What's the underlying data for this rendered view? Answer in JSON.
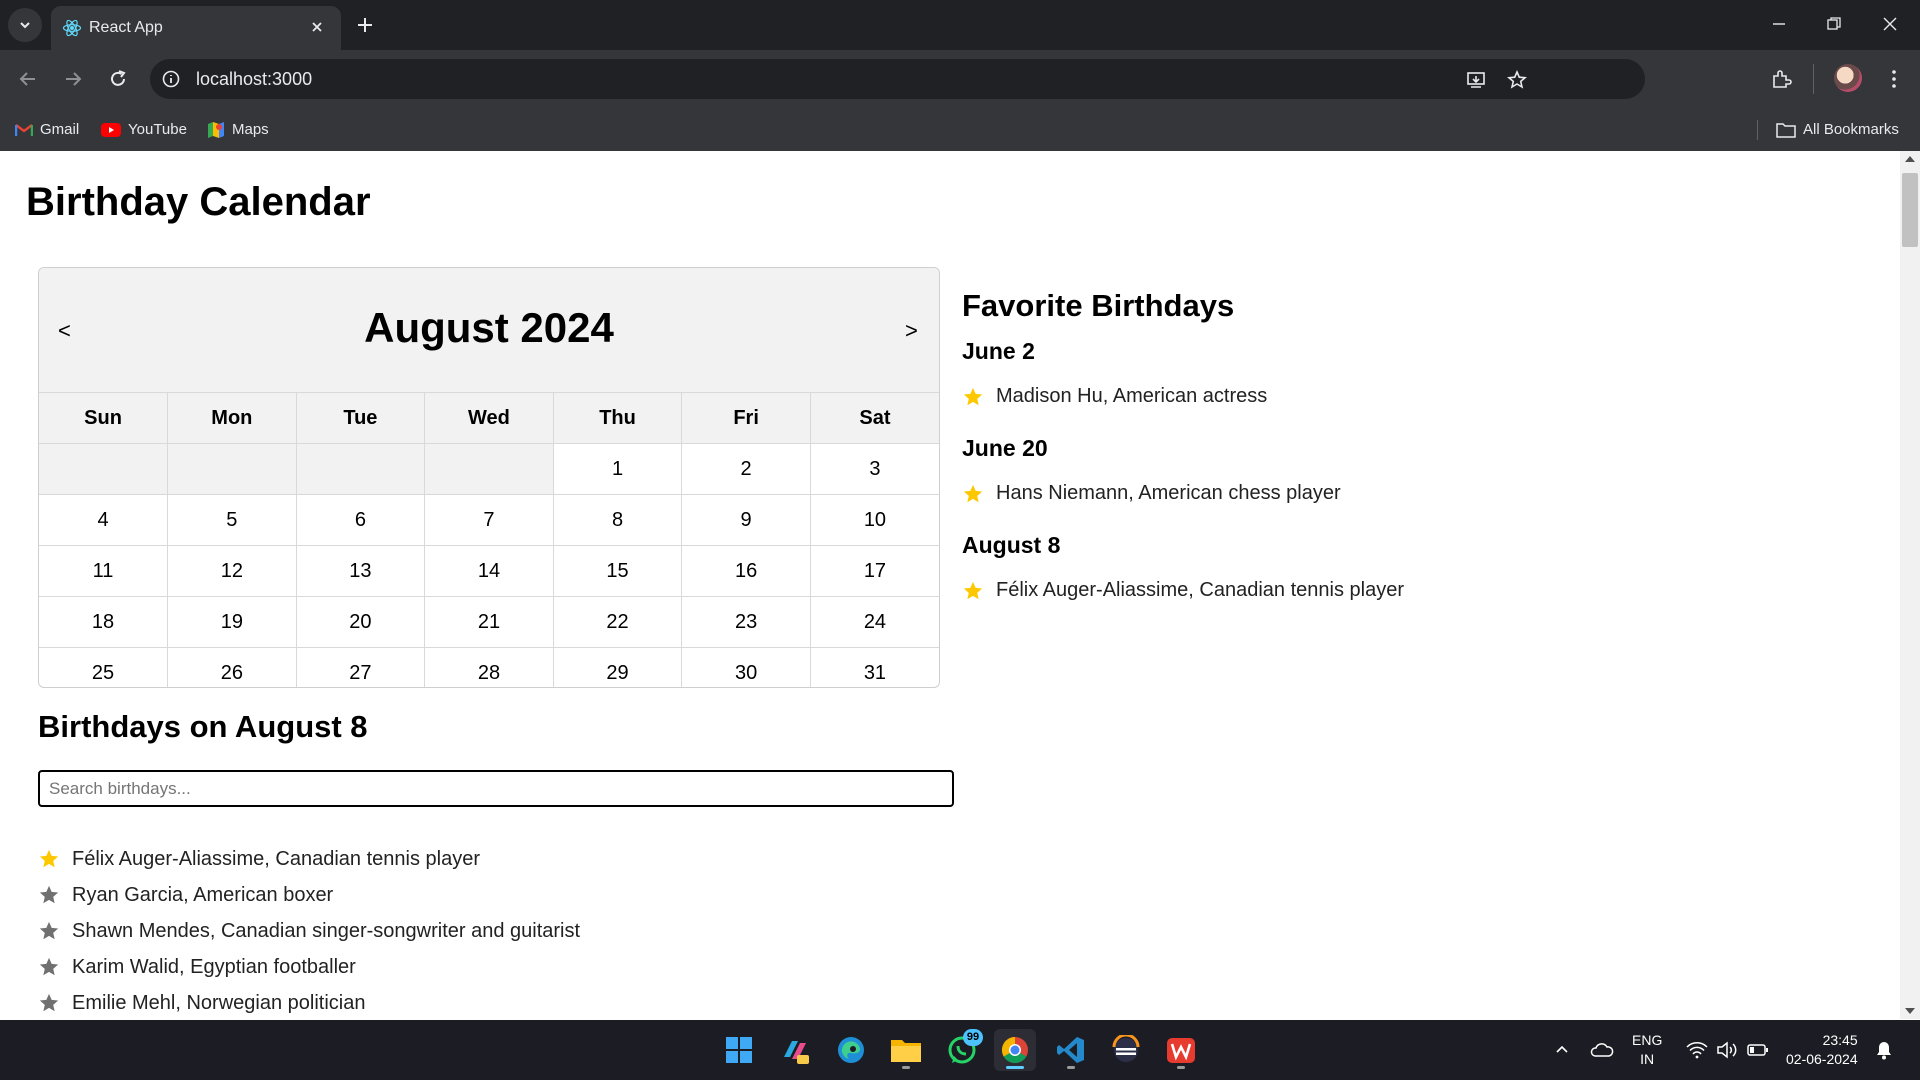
{
  "browser": {
    "tab_title": "React App",
    "url": "localhost:3000",
    "bookmarks": [
      {
        "label": "Gmail",
        "icon": "gmail-icon"
      },
      {
        "label": "YouTube",
        "icon": "youtube-icon"
      },
      {
        "label": "Maps",
        "icon": "maps-icon"
      }
    ],
    "all_bookmarks_label": "All Bookmarks"
  },
  "page": {
    "title": "Birthday Calendar",
    "calendar": {
      "prev_label": "<",
      "next_label": ">",
      "month_title": "August 2024",
      "weekdays": [
        "Sun",
        "Mon",
        "Tue",
        "Wed",
        "Thu",
        "Fri",
        "Sat"
      ],
      "weeks": [
        [
          "",
          "",
          "",
          "",
          "1",
          "2",
          "3"
        ],
        [
          "4",
          "5",
          "6",
          "7",
          "8",
          "9",
          "10"
        ],
        [
          "11",
          "12",
          "13",
          "14",
          "15",
          "16",
          "17"
        ],
        [
          "18",
          "19",
          "20",
          "21",
          "22",
          "23",
          "24"
        ],
        [
          "25",
          "26",
          "27",
          "28",
          "29",
          "30",
          "31"
        ]
      ]
    },
    "favorites": {
      "title": "Favorite Birthdays",
      "groups": [
        {
          "date": "June 2",
          "items": [
            "Madison Hu, American actress"
          ]
        },
        {
          "date": "June 20",
          "items": [
            "Hans Niemann, American chess player"
          ]
        },
        {
          "date": "August 8",
          "items": [
            "Félix Auger-Aliassime, Canadian tennis player"
          ]
        }
      ]
    },
    "birthdays": {
      "title": "Birthdays on August 8",
      "search_placeholder": "Search birthdays...",
      "items": [
        {
          "text": "Félix Auger-Aliassime, Canadian tennis player",
          "favorite": true
        },
        {
          "text": "Ryan Garcia, American boxer",
          "favorite": false
        },
        {
          "text": "Shawn Mendes, Canadian singer-songwriter and guitarist",
          "favorite": false
        },
        {
          "text": "Karim Walid, Egyptian footballer",
          "favorite": false
        },
        {
          "text": "Emilie Mehl, Norwegian politician",
          "favorite": false
        }
      ]
    },
    "colors": {
      "star_favorite": "#fdc800",
      "star_default": "#707070"
    }
  },
  "taskbar": {
    "apps": [
      "start-icon",
      "copilot-icon",
      "edge-icon",
      "file-explorer-icon",
      "whatsapp-icon",
      "chrome-icon",
      "vscode-icon",
      "app-icon",
      "wps-office-icon"
    ],
    "whatsapp_badge": "99",
    "lang_line1": "ENG",
    "lang_line2": "IN",
    "time": "23:45",
    "date": "02-06-2024"
  }
}
